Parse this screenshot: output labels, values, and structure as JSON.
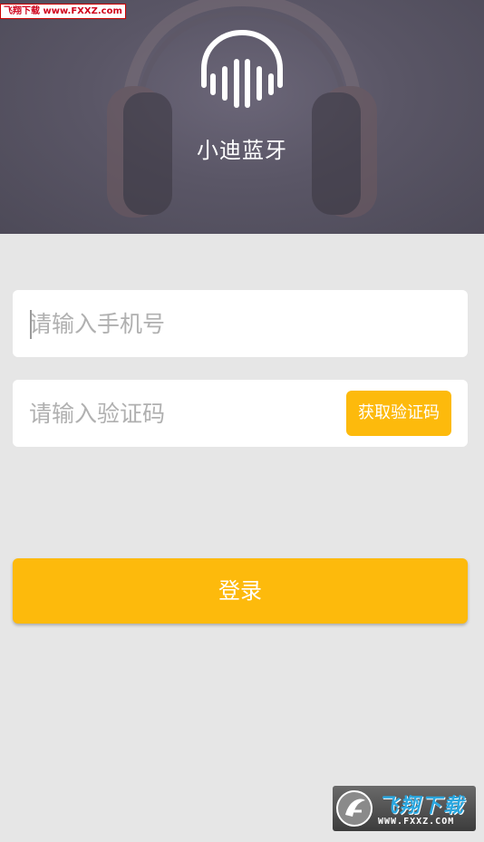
{
  "watermark_top": {
    "text": "飞翔下载 www.FXXZ.com"
  },
  "header": {
    "logo_icon": "sound-wave-headphone-icon",
    "title": "小迪蓝牙"
  },
  "form": {
    "phone": {
      "value": "",
      "placeholder": "请输入手机号"
    },
    "code": {
      "value": "",
      "placeholder": "请输入验证码"
    },
    "get_code_label": "获取验证码",
    "login_label": "登录"
  },
  "watermark_bottom": {
    "name": "飞翔下载",
    "url": "WWW.FXXZ.COM"
  },
  "colors": {
    "accent": "#fdba0c",
    "background": "#e6e6e6",
    "header": "#5a5666"
  }
}
